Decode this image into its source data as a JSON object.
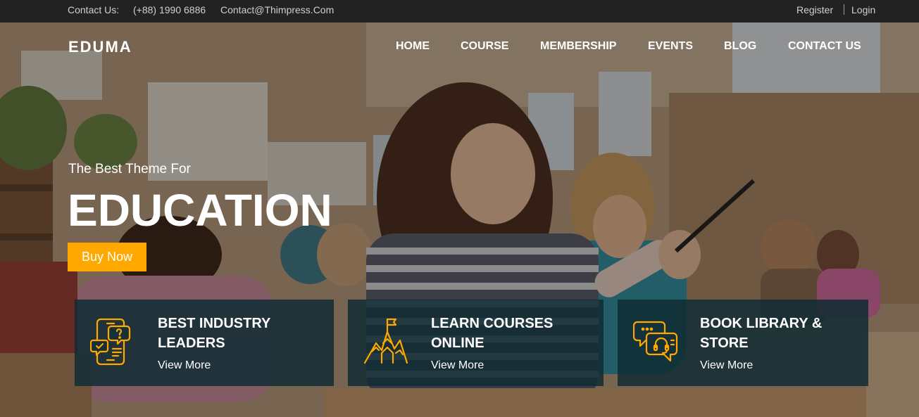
{
  "topbar": {
    "contact_label": "Contact Us:",
    "phone": "(+88) 1990 6886",
    "email": "Contact@Thimpress.Com",
    "register": "Register",
    "login": "Login"
  },
  "header": {
    "logo": "EDUMA",
    "nav": [
      "HOME",
      "COURSE",
      "MEMBERSHIP",
      "EVENTS",
      "BLOG",
      "CONTACT US"
    ]
  },
  "hero": {
    "subtitle": "The Best Theme For",
    "headline": "EDUCATION",
    "cta": "Buy Now"
  },
  "features": [
    {
      "icon": "mobile-chat-icon",
      "title_line1": "BEST INDUSTRY",
      "title_line2": "LEADERS",
      "link": "View More"
    },
    {
      "icon": "mountain-flag-icon",
      "title_line1": "LEARN COURSES",
      "title_line2": "ONLINE",
      "link": "View More"
    },
    {
      "icon": "support-chat-icon",
      "title_line1": "BOOK LIBRARY &",
      "title_line2": "STORE",
      "link": "View More"
    }
  ],
  "colors": {
    "accent": "#ffa800",
    "topbar_bg": "#222222",
    "feature_bg": "#102c34"
  }
}
